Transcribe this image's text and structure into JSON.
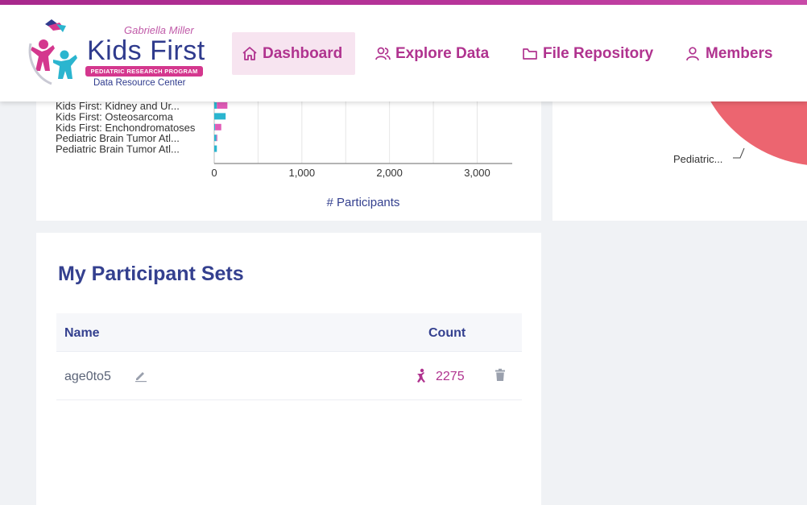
{
  "logo": {
    "brand_top": "Gabriella Miller",
    "brand_main": "Kids First",
    "brand_band": "PEDIATRIC RESEARCH PROGRAM",
    "brand_sub": "Data Resource Center"
  },
  "nav": [
    {
      "label": "Dashboard",
      "icon": "home-icon",
      "active": true
    },
    {
      "label": "Explore Data",
      "icon": "people-icon",
      "active": false
    },
    {
      "label": "File Repository",
      "icon": "folder-icon",
      "active": false
    },
    {
      "label": "Members",
      "icon": "person-icon",
      "active": false
    }
  ],
  "colors": {
    "accent": "#b0338f",
    "brand_blue": "#34408f",
    "bar_cyan": "#2bb5cf",
    "bar_pink": "#e05cb7",
    "pie_red": "#ec6570"
  },
  "chart_data": {
    "type": "bar",
    "orientation": "horizontal",
    "categories": [
      "Kids First: Kidney and Ur...",
      "Kids First: Osteosarcoma",
      "Kids First: Enchondromatoses",
      "Pediatric Brain Tumor Atl...",
      "Pediatric Brain Tumor Atl..."
    ],
    "series": [
      {
        "values": [
          30,
          130,
          10,
          25,
          30
        ]
      },
      {
        "values": [
          120,
          0,
          70,
          10,
          0
        ]
      }
    ],
    "xlabel": "# Participants",
    "xticks": [
      "0",
      "1,000",
      "2,000",
      "3,000"
    ],
    "xtick_values": [
      0,
      1000,
      2000,
      3000
    ],
    "xlim": [
      0,
      3400
    ],
    "grid": true
  },
  "pie": {
    "label": "Pediatric..."
  },
  "sets": {
    "title": "My Participant Sets",
    "columns": [
      "Name",
      "Count"
    ],
    "rows": [
      {
        "name": "age0to5",
        "count": "2275",
        "edit_icon": "pencil-icon",
        "count_icon": "participant-icon",
        "delete_icon": "trash-icon"
      }
    ]
  }
}
